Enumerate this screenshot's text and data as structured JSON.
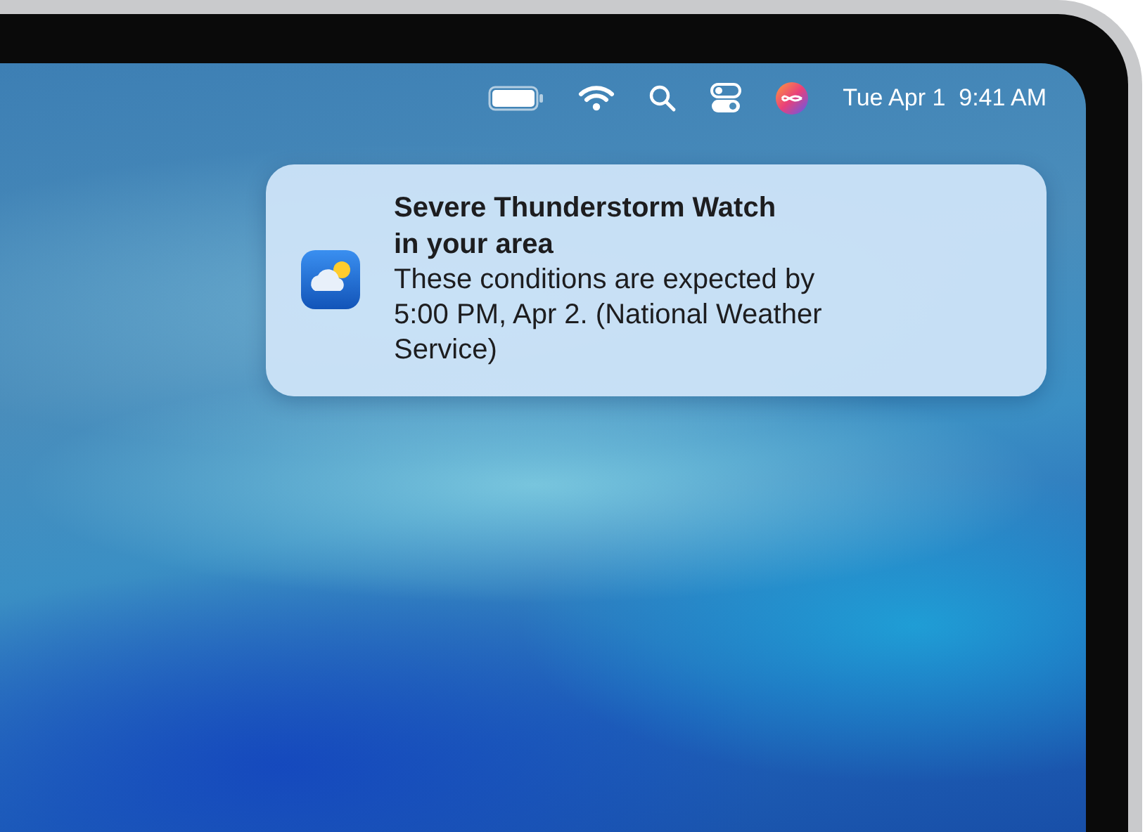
{
  "menu_bar": {
    "date": "Tue Apr 1",
    "time": "9:41 AM"
  },
  "notification": {
    "title": "Severe Thunderstorm Watch in your area",
    "body": "These conditions are expected by 5:00 PM, Apr 2. (National Weather Service)"
  }
}
